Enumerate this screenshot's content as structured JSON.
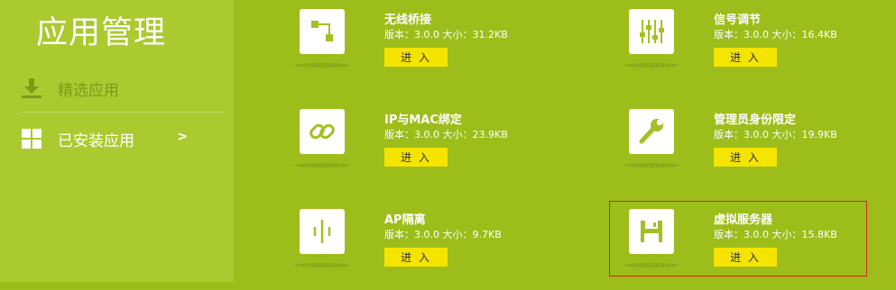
{
  "sidebar": {
    "title": "应用管理",
    "items": [
      {
        "label": "精选应用",
        "icon": "download-icon"
      },
      {
        "label": "已安装应用",
        "icon": "grid-icon",
        "arrow": ">"
      }
    ]
  },
  "apps": [
    {
      "name": "无线桥接",
      "version_label": "版本：3.0.0 大小：31.2KB",
      "button": "进 入",
      "icon": "wireless-bridge-icon"
    },
    {
      "name": "信号调节",
      "version_label": "版本：3.0.0 大小：16.4KB",
      "button": "进 入",
      "icon": "sliders-icon"
    },
    {
      "name": "IP与MAC绑定",
      "version_label": "版本：3.0.0 大小：23.9KB",
      "button": "进 入",
      "icon": "link-icon"
    },
    {
      "name": "管理员身份限定",
      "version_label": "版本：3.0.0 大小：19.9KB",
      "button": "进 入",
      "icon": "wrench-icon"
    },
    {
      "name": "AP隔离",
      "version_label": "版本：3.0.0 大小：9.7KB",
      "button": "进 入",
      "icon": "ap-isolation-icon"
    },
    {
      "name": "虚拟服务器",
      "version_label": "版本：3.0.0 大小：15.8KB",
      "button": "进 入",
      "icon": "floppy-disk-icon"
    }
  ],
  "colors": {
    "main_bg": "#9dbd1a",
    "sidebar_bg": "#aaca30",
    "button_bg": "#f4e400",
    "highlight_border": "#d82418",
    "icon_green": "#a3c024"
  }
}
